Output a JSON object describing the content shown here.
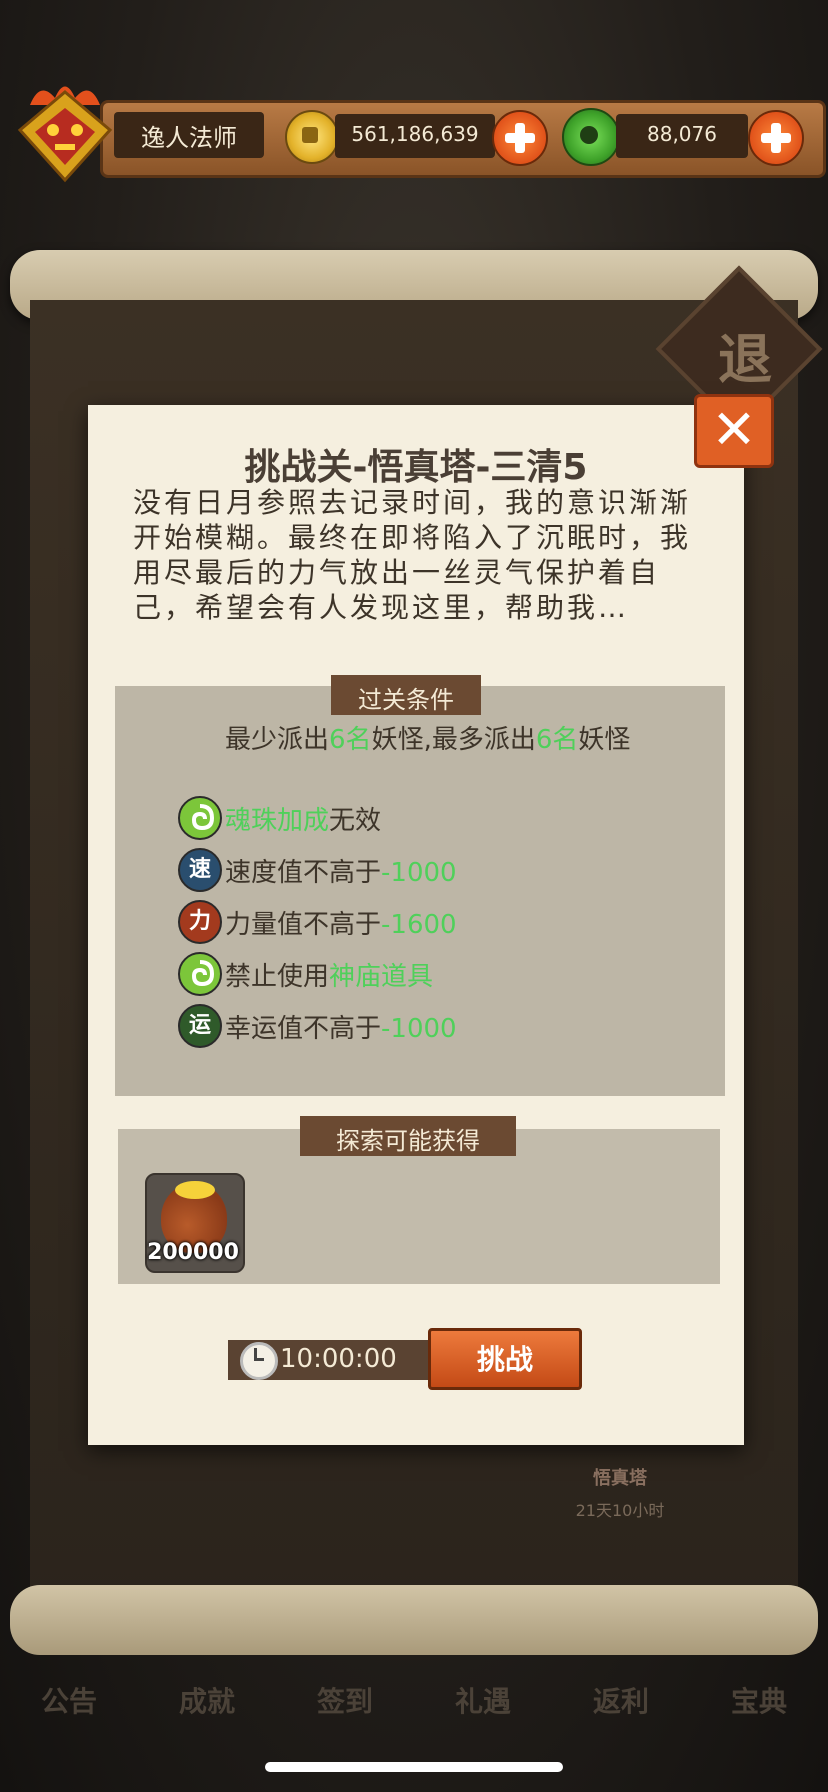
{
  "header": {
    "player_name": "逸人法师",
    "coins": "561,186,639",
    "jade": "88,076"
  },
  "background": {
    "exit_label": "退",
    "tower_label": "悟真塔",
    "tower_time": "21天10小时",
    "menu": [
      "公告",
      "成就",
      "签到",
      "礼遇",
      "返利",
      "宝典"
    ]
  },
  "dialog": {
    "title": "挑战关-悟真塔-三清5",
    "story": "没有日月参照去记录时间，我的意识渐渐开始模糊。最终在即将陷入了沉眠时，我用尽最后的力气放出一丝灵气保护着自己，希望会有人发现这里，帮助我…",
    "conditions_header": "过关条件",
    "limit": {
      "p1": "最少派出",
      "min": "6名",
      "p2": "妖怪,最多派出",
      "max": "6名",
      "p3": "妖怪"
    },
    "conditions": [
      {
        "icon": "soul-icon",
        "glyph": "",
        "color": "#7cc63a",
        "highlight": "魂珠加成",
        "text": "无效",
        "highlight_first": true
      },
      {
        "icon": "speed-icon",
        "glyph": "速",
        "color": "#2a4e6e",
        "text": "速度值不高于",
        "highlight": "-1000"
      },
      {
        "icon": "power-icon",
        "glyph": "力",
        "color": "#a33a1e",
        "text": "力量值不高于",
        "highlight": "-1600"
      },
      {
        "icon": "soul-icon",
        "glyph": "",
        "color": "#7cc63a",
        "text": "禁止使用",
        "highlight": "神庙道具"
      },
      {
        "icon": "luck-icon",
        "glyph": "运",
        "color": "#2f5a2a",
        "text": "幸运值不高于",
        "highlight": "-1000"
      }
    ],
    "rewards_header": "探索可能获得",
    "reward_qty": "200000",
    "timer": "10:00:00",
    "challenge_label": "挑战"
  },
  "colors": {
    "highlight": "#4fd05a",
    "button": "#e06025"
  }
}
